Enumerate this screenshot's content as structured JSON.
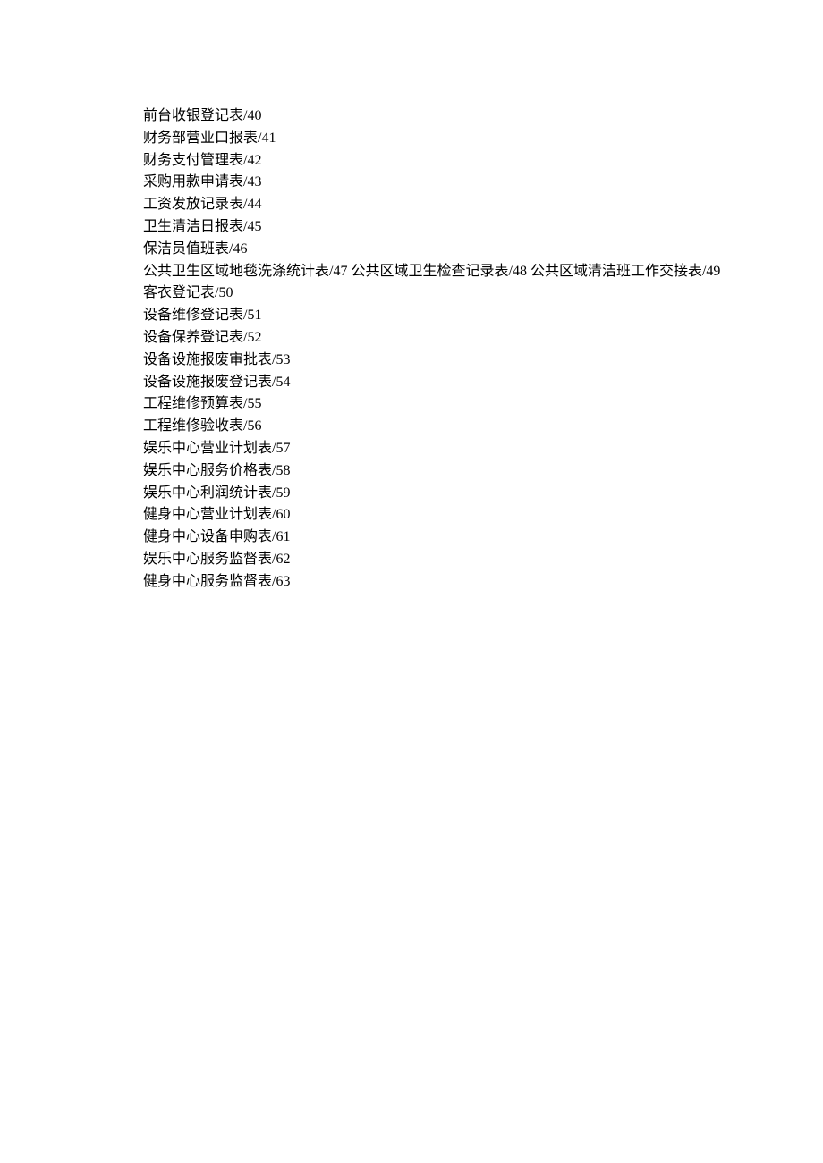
{
  "toc": {
    "lines": [
      [
        {
          "title": "前台收银登记表",
          "page": "40"
        }
      ],
      [
        {
          "title": "财务部营业口报表",
          "page": "41"
        }
      ],
      [
        {
          "title": "财务支付管理表",
          "page": "42"
        }
      ],
      [
        {
          "title": "采购用款申请表",
          "page": "43"
        }
      ],
      [
        {
          "title": "工资发放记录表",
          "page": "44"
        }
      ],
      [
        {
          "title": "卫生清洁日报表",
          "page": "45"
        }
      ],
      [
        {
          "title": "保洁员值班表",
          "page": "46"
        }
      ],
      [
        {
          "title": "公共卫生区域地毯洗涤统计表",
          "page": "47"
        },
        {
          "title": "公共区域卫生检查记录表",
          "page": "48"
        },
        {
          "title": "公共区域清洁班工作交接表",
          "page": "49"
        }
      ],
      [
        {
          "title": "客衣登记表",
          "page": "50"
        }
      ],
      [
        {
          "title": "设备维修登记表",
          "page": "51"
        }
      ],
      [
        {
          "title": "设备保养登记表",
          "page": "52"
        }
      ],
      [
        {
          "title": "设备设施报废审批表",
          "page": "53"
        }
      ],
      [
        {
          "title": "设备设施报废登记表",
          "page": "54"
        }
      ],
      [
        {
          "title": "工程维修预算表",
          "page": "55"
        }
      ],
      [
        {
          "title": "工程维修验收表",
          "page": "56"
        }
      ],
      [
        {
          "title": "娱乐中心营业计划表",
          "page": "57"
        }
      ],
      [
        {
          "title": "娱乐中心服务价格表",
          "page": "58"
        }
      ],
      [
        {
          "title": "娱乐中心利润统计表",
          "page": "59"
        }
      ],
      [
        {
          "title": "健身中心营业计划表",
          "page": "60"
        }
      ],
      [
        {
          "title": "健身中心设备申购表",
          "page": "61"
        }
      ],
      [
        {
          "title": "娱乐中心服务监督表",
          "page": "62"
        }
      ],
      [
        {
          "title": "健身中心服务监督表",
          "page": "63"
        }
      ]
    ]
  }
}
